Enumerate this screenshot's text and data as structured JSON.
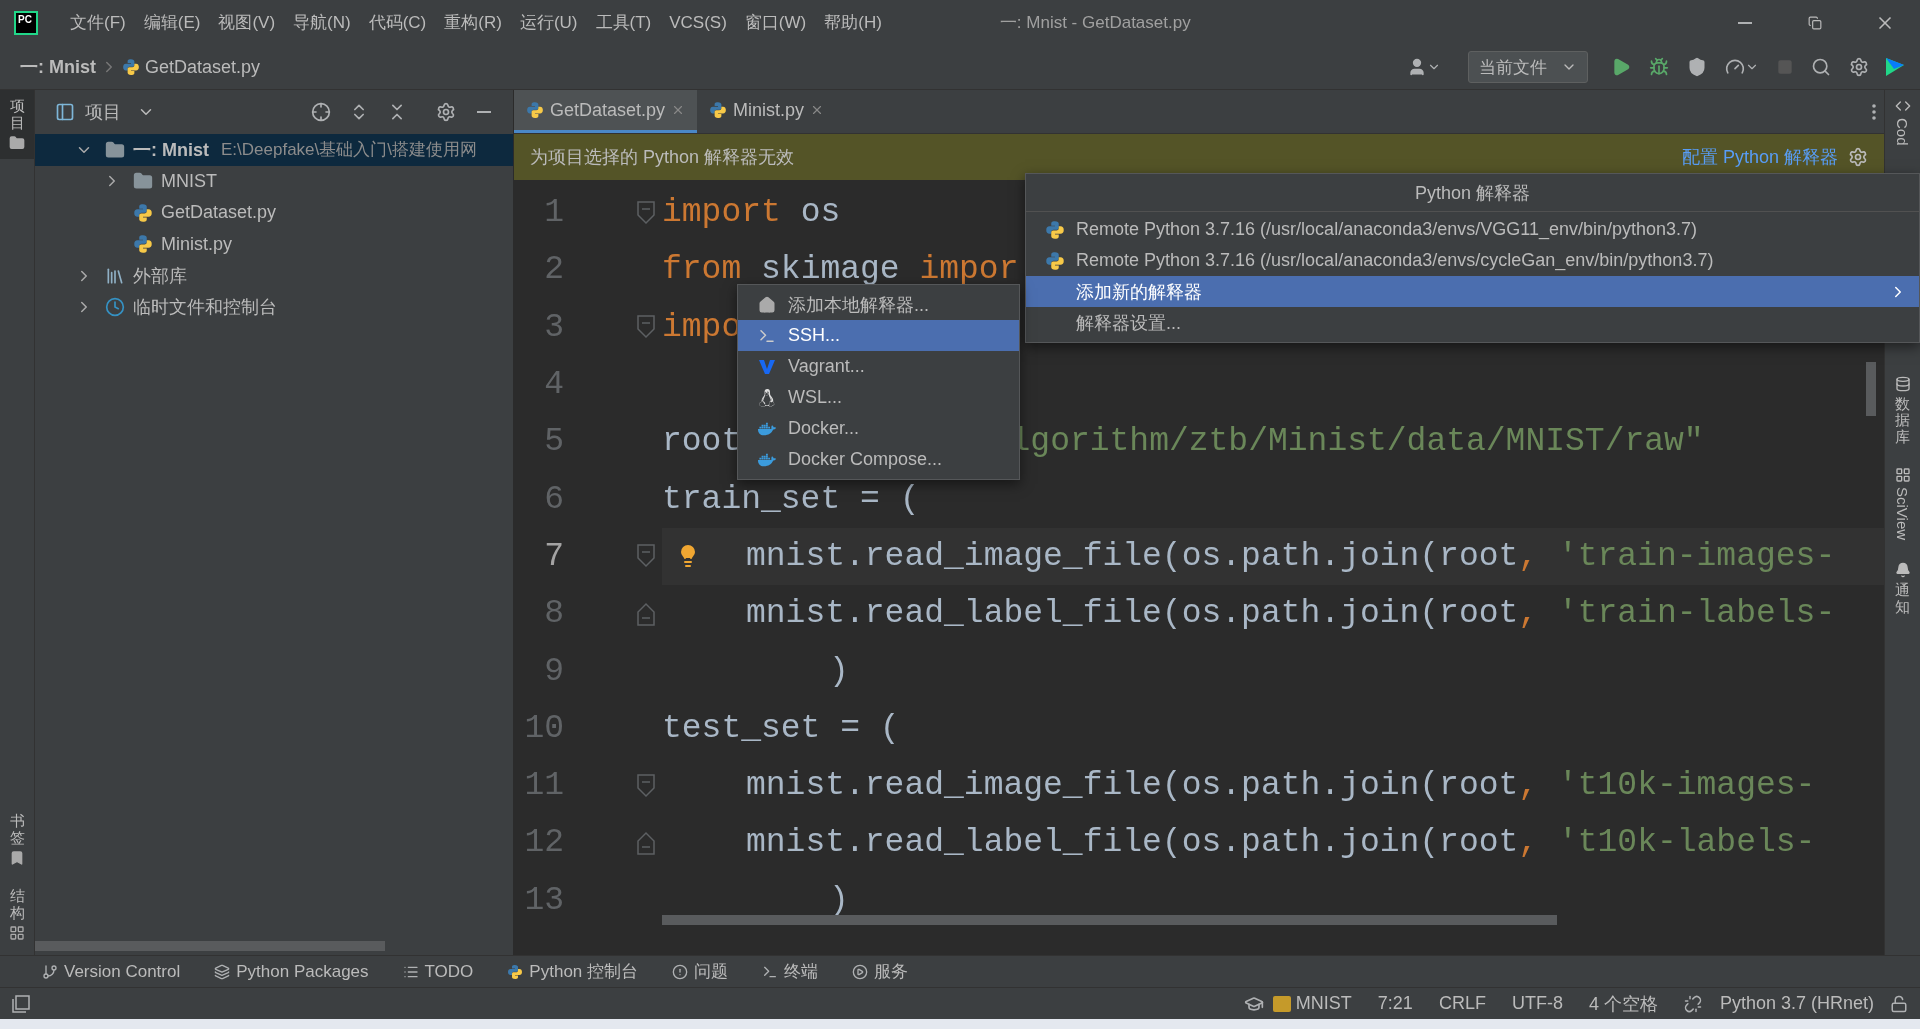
{
  "app": {
    "logo": "PC",
    "menu": [
      "文件(F)",
      "编辑(E)",
      "视图(V)",
      "导航(N)",
      "代码(C)",
      "重构(R)",
      "运行(U)",
      "工具(T)",
      "VCS(S)",
      "窗口(W)",
      "帮助(H)"
    ],
    "title": "一:  Mnist - GetDataset.py"
  },
  "breadcrumb": {
    "project": "一:  Mnist",
    "file": "GetDataset.py"
  },
  "run_config": "当前文件",
  "left_stripe": [
    {
      "kind": "project",
      "label": "项目",
      "selected": true
    },
    {
      "kind": "bookmarks",
      "label": "书签",
      "selected": false
    },
    {
      "kind": "structure",
      "label": "结构",
      "selected": false
    }
  ],
  "right_stripe": [
    {
      "kind": "code",
      "label": "Cod"
    },
    {
      "kind": "database",
      "label": "数据库"
    },
    {
      "kind": "sciview",
      "label": "SciView"
    },
    {
      "kind": "notifications",
      "label": "通知"
    }
  ],
  "project_panel": {
    "title": "项目",
    "tree": [
      {
        "kind": "project",
        "label": "一:  Mnist",
        "path": "E:\\Deepfake\\基础入门\\搭建使用网",
        "expanded": true,
        "selected": true,
        "children": [
          {
            "kind": "folder",
            "label": "MNIST",
            "expanded": false,
            "selected": false
          },
          {
            "kind": "python",
            "label": "GetDataset.py",
            "selected": false
          },
          {
            "kind": "python",
            "label": "Minist.py",
            "selected": false
          }
        ]
      },
      {
        "kind": "library",
        "label": "外部库",
        "expanded": false,
        "selected": false
      },
      {
        "kind": "scratch",
        "label": "临时文件和控制台",
        "expanded": false,
        "selected": false
      }
    ]
  },
  "editor": {
    "tabs": [
      {
        "label": "GetDataset.py",
        "selected": true
      },
      {
        "label": "Minist.py",
        "selected": false
      }
    ],
    "banner": {
      "message": "为项目选择的 Python 解释器无效",
      "link": "配置 Python 解释器"
    },
    "lines": [
      {
        "number": "1",
        "kind": "top",
        "current": false,
        "bulb": false,
        "fold_start": true,
        "fold_end": false,
        "tokens": [
          {
            "kind": "kw",
            "text": "import"
          },
          {
            "kind": "plain",
            "text": " os"
          }
        ]
      },
      {
        "number": "2",
        "kind": "top",
        "current": false,
        "bulb": false,
        "fold_start": false,
        "fold_end": false,
        "tokens": [
          {
            "kind": "kw",
            "text": "from"
          },
          {
            "kind": "plain",
            "text": " skimage "
          },
          {
            "kind": "kw",
            "text": "impor"
          }
        ]
      },
      {
        "number": "3",
        "kind": "top",
        "current": false,
        "bulb": false,
        "fold_start": true,
        "fold_end": false,
        "tokens": [
          {
            "kind": "kw",
            "text": "impo"
          }
        ]
      },
      {
        "number": "4",
        "kind": "top",
        "current": false,
        "bulb": false,
        "fold_start": false,
        "fold_end": false
      },
      {
        "number": "5",
        "kind": "top",
        "current": false,
        "bulb": false,
        "fold_start": false,
        "fold_end": false,
        "tokens": [
          {
            "kind": "plain",
            "text": "root"
          },
          {
            "kind": "covered"
          },
          {
            "kind": "str",
            "text": "lgorithm/ztb/Minist/data/MNIST/raw\""
          }
        ]
      },
      {
        "number": "6",
        "kind": "top",
        "current": false,
        "bulb": false,
        "fold_start": false,
        "fold_end": false,
        "tokens": [
          {
            "kind": "plain",
            "text": "train_set = ("
          }
        ]
      },
      {
        "number": "7",
        "kind": "argument",
        "current": true,
        "bulb": true,
        "fold_start": true,
        "fold_end": false,
        "tokens": [
          {
            "kind": "plain",
            "text": "mnist.read_image_file(os.path.join(root"
          },
          {
            "kind": "punct",
            "text": ","
          },
          {
            "kind": "str",
            "text": " 'train-images-"
          }
        ]
      },
      {
        "number": "8",
        "kind": "argument",
        "current": false,
        "bulb": false,
        "fold_start": false,
        "fold_end": true,
        "tokens": [
          {
            "kind": "plain",
            "text": "mnist.read_label_file(os.path.join(root"
          },
          {
            "kind": "punct",
            "text": ","
          },
          {
            "kind": "str",
            "text": " 'train-labels-"
          }
        ]
      },
      {
        "number": "9",
        "kind": "closing",
        "current": false,
        "bulb": false,
        "fold_start": false,
        "fold_end": false,
        "tokens": [
          {
            "kind": "plain",
            "text": ")"
          }
        ]
      },
      {
        "number": "10",
        "kind": "top",
        "current": false,
        "bulb": false,
        "fold_start": false,
        "fold_end": false,
        "tokens": [
          {
            "kind": "plain",
            "text": "test_set = ("
          }
        ]
      },
      {
        "number": "11",
        "kind": "argument",
        "current": false,
        "bulb": false,
        "fold_start": true,
        "fold_end": false,
        "tokens": [
          {
            "kind": "plain",
            "text": "mnist.read_image_file(os.path.join(root"
          },
          {
            "kind": "punct",
            "text": ","
          },
          {
            "kind": "str",
            "text": " 't10k-images-"
          }
        ]
      },
      {
        "number": "12",
        "kind": "argument",
        "current": false,
        "bulb": false,
        "fold_start": false,
        "fold_end": true,
        "tokens": [
          {
            "kind": "plain",
            "text": "mnist.read_label_file(os.path.join(root"
          },
          {
            "kind": "punct",
            "text": ","
          },
          {
            "kind": "str",
            "text": " 't10k-labels-"
          }
        ]
      },
      {
        "number": "13",
        "kind": "closing",
        "current": false,
        "bulb": false,
        "fold_start": false,
        "fold_end": false,
        "tokens": [
          {
            "kind": "plain",
            "text": ")"
          }
        ]
      }
    ]
  },
  "interpreter_popup": {
    "title": "Python 解释器",
    "items": [
      {
        "kind": "interpreter",
        "label": "Remote Python 3.7.16 (/usr/local/anaconda3/envs/VGG11_env/bin/python3.7)",
        "selected": false
      },
      {
        "kind": "interpreter",
        "label": "Remote Python 3.7.16 (/usr/local/anaconda3/envs/cycleGan_env/bin/python3.7)",
        "selected": false
      },
      {
        "kind": "submenu",
        "label": "添加新的解释器",
        "selected": true
      },
      {
        "kind": "action",
        "label": "解释器设置...",
        "selected": false
      }
    ]
  },
  "add_interpreter_menu": {
    "items": [
      {
        "kind": "local",
        "label": "添加本地解释器...",
        "selected": false
      },
      {
        "kind": "ssh",
        "label": "SSH...",
        "selected": true
      },
      {
        "kind": "vagrant",
        "label": "Vagrant...",
        "selected": false
      },
      {
        "kind": "wsl",
        "label": "WSL...",
        "selected": false
      },
      {
        "kind": "docker",
        "label": "Docker...",
        "selected": false
      },
      {
        "kind": "docker",
        "label": "Docker Compose...",
        "selected": false
      }
    ]
  },
  "tool_windows": [
    {
      "kind": "vcs",
      "label": "Version Control"
    },
    {
      "kind": "packages",
      "label": "Python Packages"
    },
    {
      "kind": "todo",
      "label": "TODO"
    },
    {
      "kind": "console",
      "label": "Python 控制台"
    },
    {
      "kind": "problems",
      "label": "问题"
    },
    {
      "kind": "terminal",
      "label": "终端"
    },
    {
      "kind": "services",
      "label": "服务"
    }
  ],
  "status_bar": [
    {
      "kind": "sftp",
      "label": "MNIST"
    },
    {
      "kind": "text",
      "label": "7:21"
    },
    {
      "kind": "text",
      "label": "CRLF"
    },
    {
      "kind": "text",
      "label": "UTF-8"
    },
    {
      "kind": "text",
      "label": "4 个空格"
    },
    {
      "kind": "interpreter",
      "label": "Python 3.7 (HRnet)"
    }
  ]
}
